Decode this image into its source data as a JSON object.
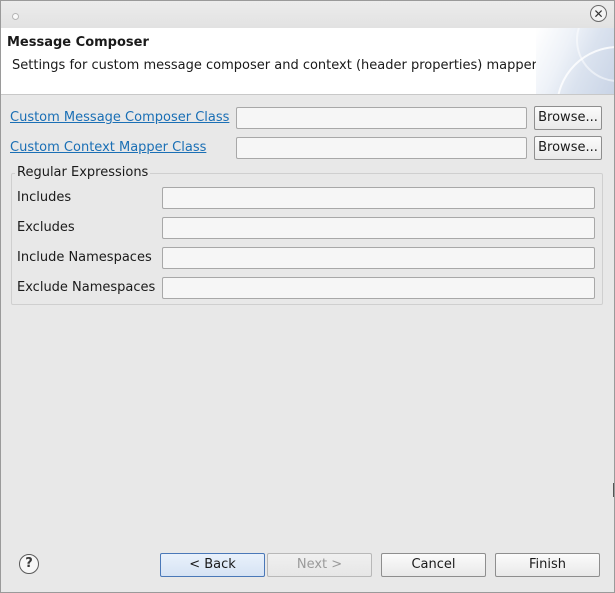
{
  "window": {
    "close_symbol": "✕"
  },
  "header": {
    "title": "Message Composer",
    "description": "Settings for custom message composer and context (header properties) mapper."
  },
  "composer": {
    "composer_class_label": "Custom Message Composer Class",
    "composer_class_value": "",
    "mapper_class_label": "Custom Context Mapper Class",
    "mapper_class_value": "",
    "browse_label": "Browse..."
  },
  "regex_group": {
    "title": "Regular Expressions",
    "fields": [
      {
        "label": "Includes",
        "value": ""
      },
      {
        "label": "Excludes",
        "value": ""
      },
      {
        "label": "Include Namespaces",
        "value": ""
      },
      {
        "label": "Exclude Namespaces",
        "value": ""
      }
    ]
  },
  "footer": {
    "help_symbol": "?",
    "back_label": "< Back",
    "next_label": "Next >",
    "cancel_label": "Cancel",
    "finish_label": "Finish"
  },
  "icons": {
    "help": "help-icon",
    "close": "close-icon",
    "window_menu": "window-menu-icon"
  }
}
